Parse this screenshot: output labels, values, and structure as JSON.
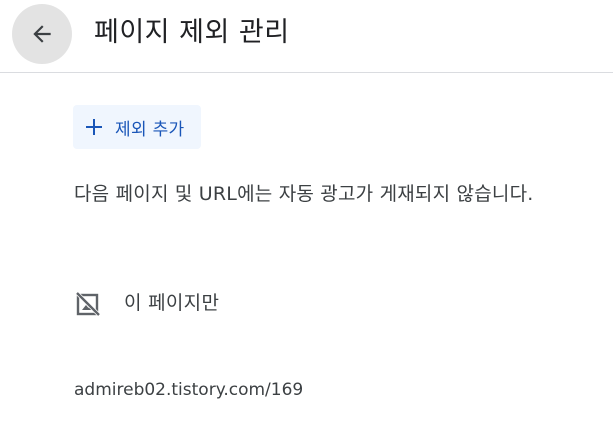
{
  "header": {
    "back_icon": "arrow-left-icon",
    "title": "페이지 제외 관리"
  },
  "actions": {
    "add_exclusion_label": "제외 추가",
    "add_icon": "plus-icon",
    "accent_color": "#1a56b8"
  },
  "description": "다음 페이지 및 URL에는 자동 광고가 게재되지 않습니다.",
  "exclusions": [
    {
      "icon": "hide-image-icon",
      "scope_label": "이 페이지만",
      "url": "admireb02.tistory.com/169"
    }
  ]
}
